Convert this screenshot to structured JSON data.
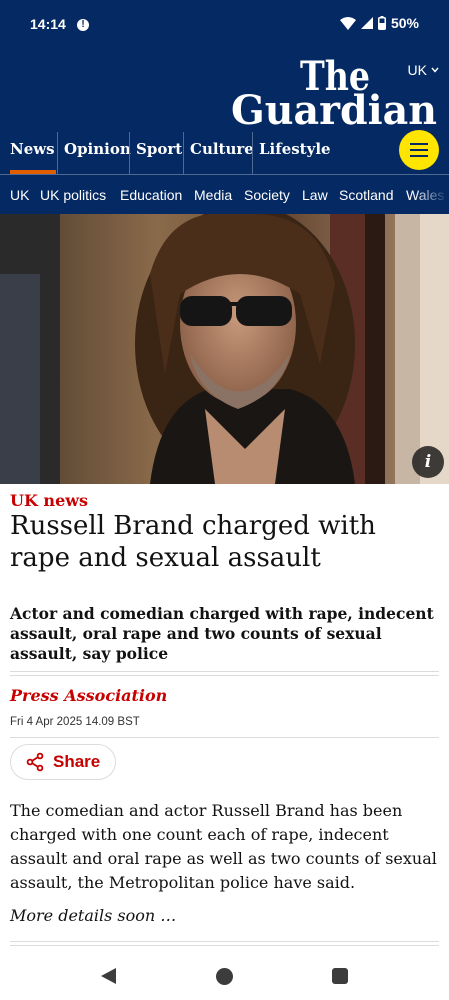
{
  "status_bar": {
    "time": "14:14",
    "battery": "50%"
  },
  "masthead": {
    "edition": "UK",
    "logo_line1": "The",
    "logo_line2": "Guardian"
  },
  "pillars": [
    {
      "label": "News",
      "active": true
    },
    {
      "label": "Opinion"
    },
    {
      "label": "Sport"
    },
    {
      "label": "Culture"
    },
    {
      "label": "Lifestyle"
    }
  ],
  "subnav": [
    "UK",
    "UK politics",
    "Education",
    "Media",
    "Society",
    "Law",
    "Scotland",
    "Wales"
  ],
  "article": {
    "image_info_label": "i",
    "kicker": "UK news",
    "headline": "Russell Brand charged with rape and sexual assault",
    "standfirst": "Actor and comedian charged with rape, indecent assault, oral rape and two counts of sexual assault, say police",
    "byline": "Press Association",
    "dateline": "Fri 4 Apr 2025 14.09 BST",
    "share_label": "Share",
    "body": "The comedian and actor Russell Brand has been charged with one count each of rape, indecent assault and oral rape as well as two counts of sexual assault, the Metropolitan police have said.",
    "more": "More details soon …"
  },
  "colors": {
    "brand_blue": "#052962",
    "news_red": "#c70000",
    "menu_yellow": "#ffe500",
    "active_underline": "#e05e00"
  }
}
